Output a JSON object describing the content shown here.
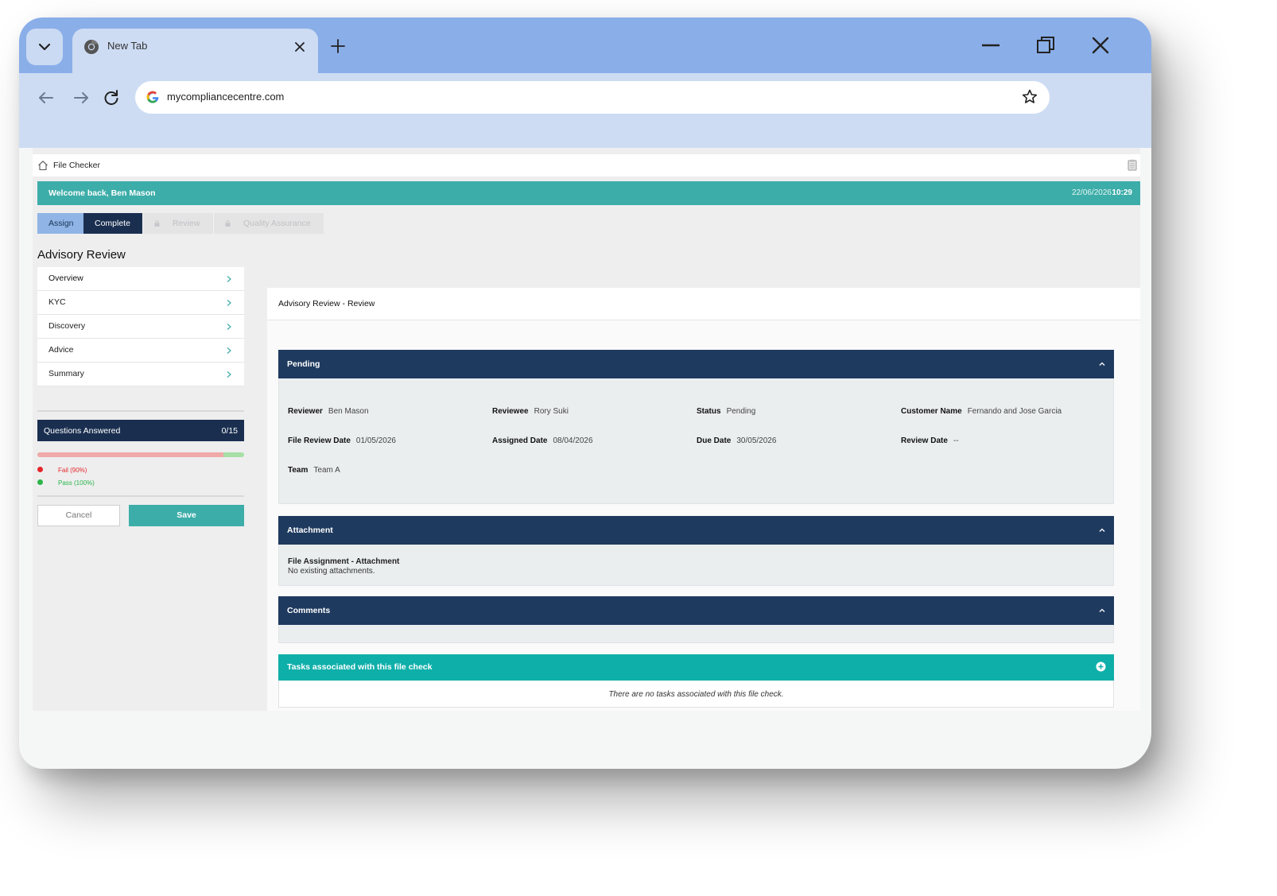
{
  "browser": {
    "tab_title": "New Tab",
    "url": "mycompliancecentre.com"
  },
  "app": {
    "breadcrumb": "File Checker",
    "welcome": "Welcome back, Ben Mason",
    "date": "22/06/2026",
    "time": "10:29",
    "steps": [
      {
        "label": "Assign",
        "state": "done"
      },
      {
        "label": "Complete",
        "state": "active"
      },
      {
        "label": "Review",
        "state": "locked"
      },
      {
        "label": "Quality Assurance",
        "state": "locked"
      }
    ],
    "page_title": "Advisory Review"
  },
  "sidebar": {
    "items": [
      {
        "label": "Overview"
      },
      {
        "label": "KYC"
      },
      {
        "label": "Discovery"
      },
      {
        "label": "Advice"
      },
      {
        "label": "Summary"
      }
    ],
    "questions_label": "Questions Answered",
    "questions_count": "0/15",
    "progress": {
      "fail_fraction": 0.9,
      "pass_fraction": 0.1
    },
    "legend": {
      "fail": "Fail (90%)",
      "pass": "Pass (100%)"
    },
    "cancel_label": "Cancel",
    "save_label": "Save"
  },
  "main": {
    "header": "Advisory Review - Review",
    "pending": {
      "title": "Pending",
      "fields": [
        {
          "key": "Reviewer",
          "value": "Ben Mason"
        },
        {
          "key": "Reviewee",
          "value": "Rory Suki"
        },
        {
          "key": "Status",
          "value": "Pending"
        },
        {
          "key": "Customer Name",
          "value": "Fernando and Jose Garcia"
        },
        {
          "key": "File Review Date",
          "value": "01/05/2026"
        },
        {
          "key": "Assigned Date",
          "value": "08/04/2026"
        },
        {
          "key": "Due Date",
          "value": "30/05/2026"
        },
        {
          "key": "Review Date",
          "value": "--"
        },
        {
          "key": "Team",
          "value": "Team A"
        }
      ]
    },
    "attachment": {
      "title": "Attachment",
      "subtitle": "File Assignment - Attachment",
      "empty_text": "No existing attachments."
    },
    "comments": {
      "title": "Comments"
    },
    "tasks": {
      "title": "Tasks associated with this file check",
      "empty_text": "There are no tasks associated with this file check."
    }
  },
  "colors": {
    "teal": "#3dada9",
    "navy": "#1a2f50",
    "section_navy": "#1f3a5f",
    "tasks_teal": "#0fafa9",
    "fail_red": "#e5262c",
    "pass_green": "#2bb54a"
  }
}
